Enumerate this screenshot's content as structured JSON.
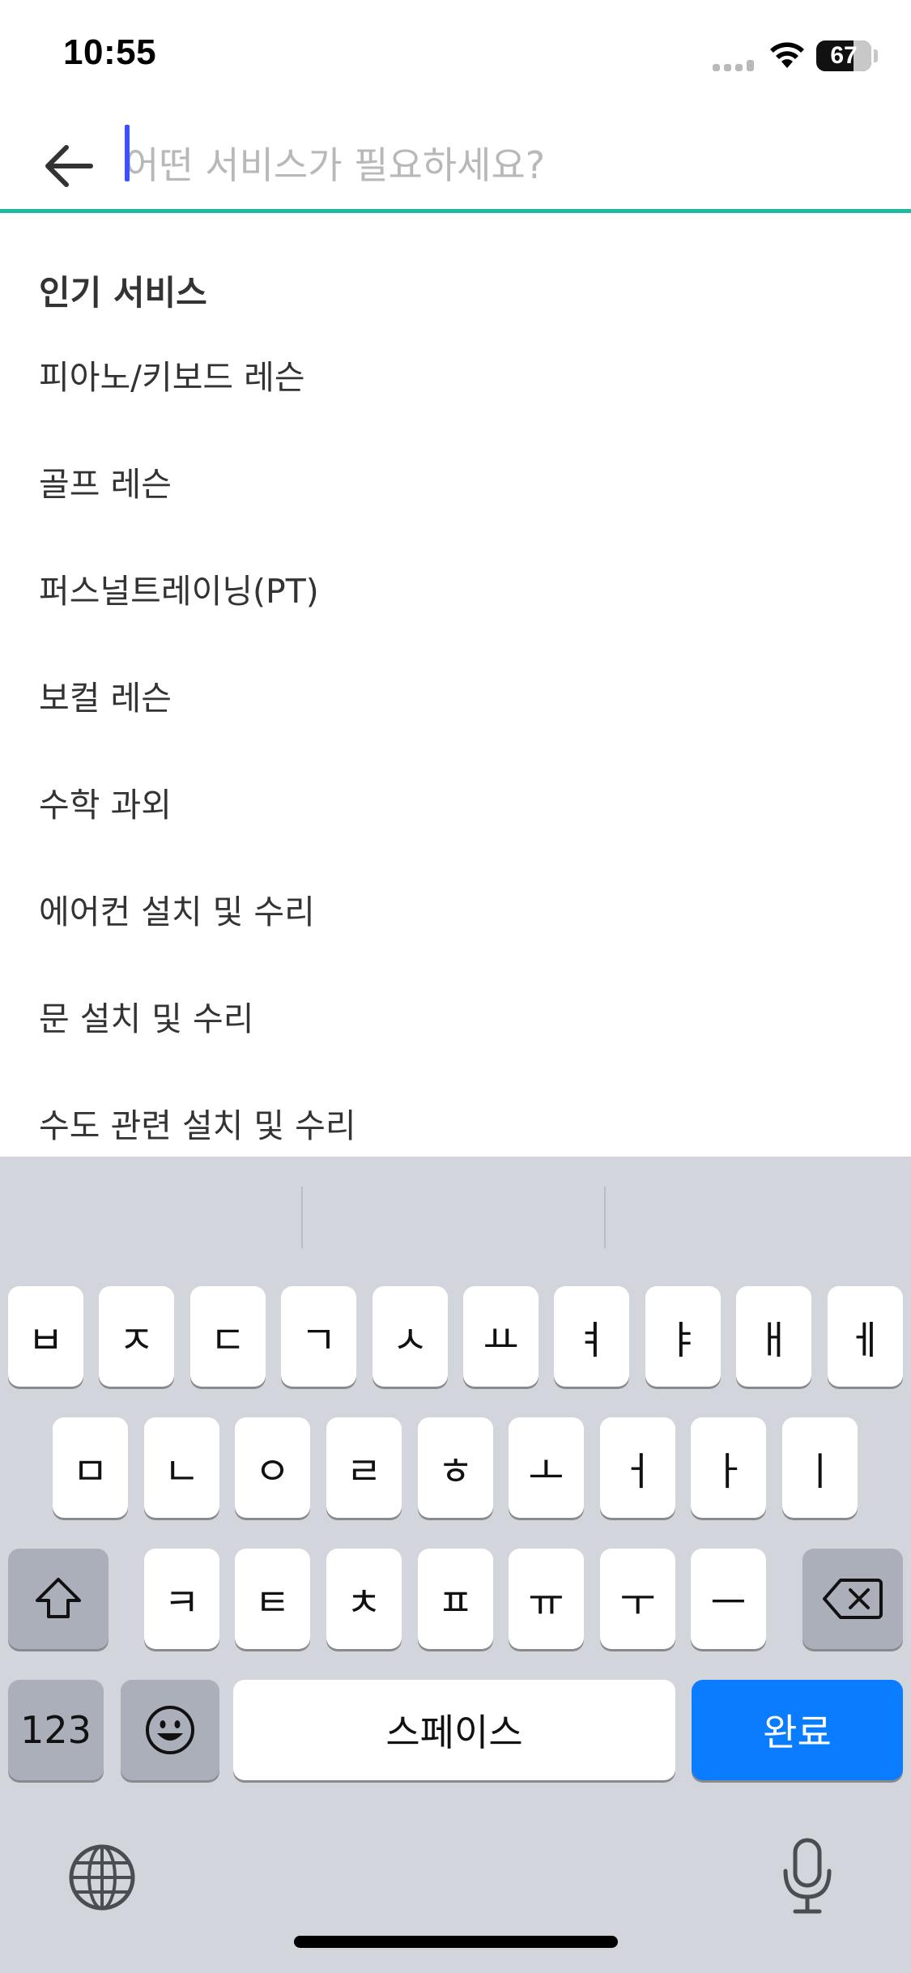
{
  "status_bar": {
    "time": "10:55",
    "battery_level": "67",
    "icons": [
      "cellular-signal-icon",
      "wifi-icon",
      "battery-icon"
    ]
  },
  "search": {
    "placeholder": "어떤 서비스가 필요하세요?",
    "value": "",
    "accent_color": "#1fb9a6",
    "caret_color": "#3b50ff",
    "back_icon": "back-arrow-icon"
  },
  "popular": {
    "title": "인기 서비스",
    "items": [
      "피아노/키보드 레슨",
      "골프 레슨",
      "퍼스널트레이닝(PT)",
      "보컬 레슨",
      "수학 과외",
      "에어컨 설치 및 수리",
      "문 설치 및 수리",
      "수도 관련 설치 및 수리"
    ]
  },
  "keyboard": {
    "row1": [
      "ㅂ",
      "ㅈ",
      "ㄷ",
      "ㄱ",
      "ㅅ",
      "ㅛ",
      "ㅕ",
      "ㅑ",
      "ㅐ",
      "ㅔ"
    ],
    "row2": [
      "ㅁ",
      "ㄴ",
      "ㅇ",
      "ㄹ",
      "ㅎ",
      "ㅗ",
      "ㅓ",
      "ㅏ",
      "ㅣ"
    ],
    "row3": [
      "ㅋ",
      "ㅌ",
      "ㅊ",
      "ㅍ",
      "ㅠ",
      "ㅜ",
      "ㅡ"
    ],
    "numbers_label": "123",
    "space_label": "스페이스",
    "done_label": "완료",
    "done_color": "#0a7cff",
    "icons": [
      "shift-icon",
      "delete-icon",
      "emoji-icon",
      "globe-icon",
      "microphone-icon"
    ]
  }
}
